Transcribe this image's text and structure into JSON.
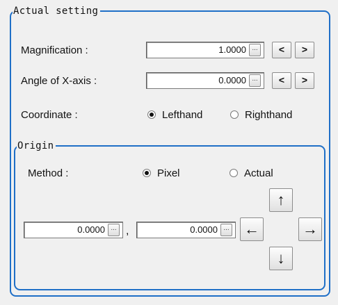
{
  "actual_setting": {
    "title": "Actual setting",
    "magnification": {
      "label": "Magnification :",
      "value": "1.0000",
      "ellipsis": "...",
      "dec": "<",
      "inc": ">"
    },
    "angle": {
      "label": "Angle of X-axis :",
      "value": "0.0000",
      "ellipsis": "...",
      "dec": "<",
      "inc": ">"
    },
    "coordinate": {
      "label": "Coordinate :",
      "options": [
        "Lefthand",
        "Righthand"
      ],
      "selected": "Lefthand"
    }
  },
  "origin": {
    "title": "Origin",
    "method": {
      "label": "Method :",
      "options": [
        "Pixel",
        "Actual"
      ],
      "selected": "Pixel"
    },
    "x_value": "0.0000",
    "y_value": "0.0000",
    "separator": ",",
    "ellipsis": "...",
    "arrows": {
      "up": "↑",
      "left": "←",
      "right": "→",
      "down": "↓"
    }
  },
  "colors": {
    "frame": "#1f6fc7",
    "panel": "#f0f0f0"
  },
  "icons": [
    "ellipsis-icon",
    "arrow-up-icon",
    "arrow-left-icon",
    "arrow-right-icon",
    "arrow-down-icon"
  ]
}
